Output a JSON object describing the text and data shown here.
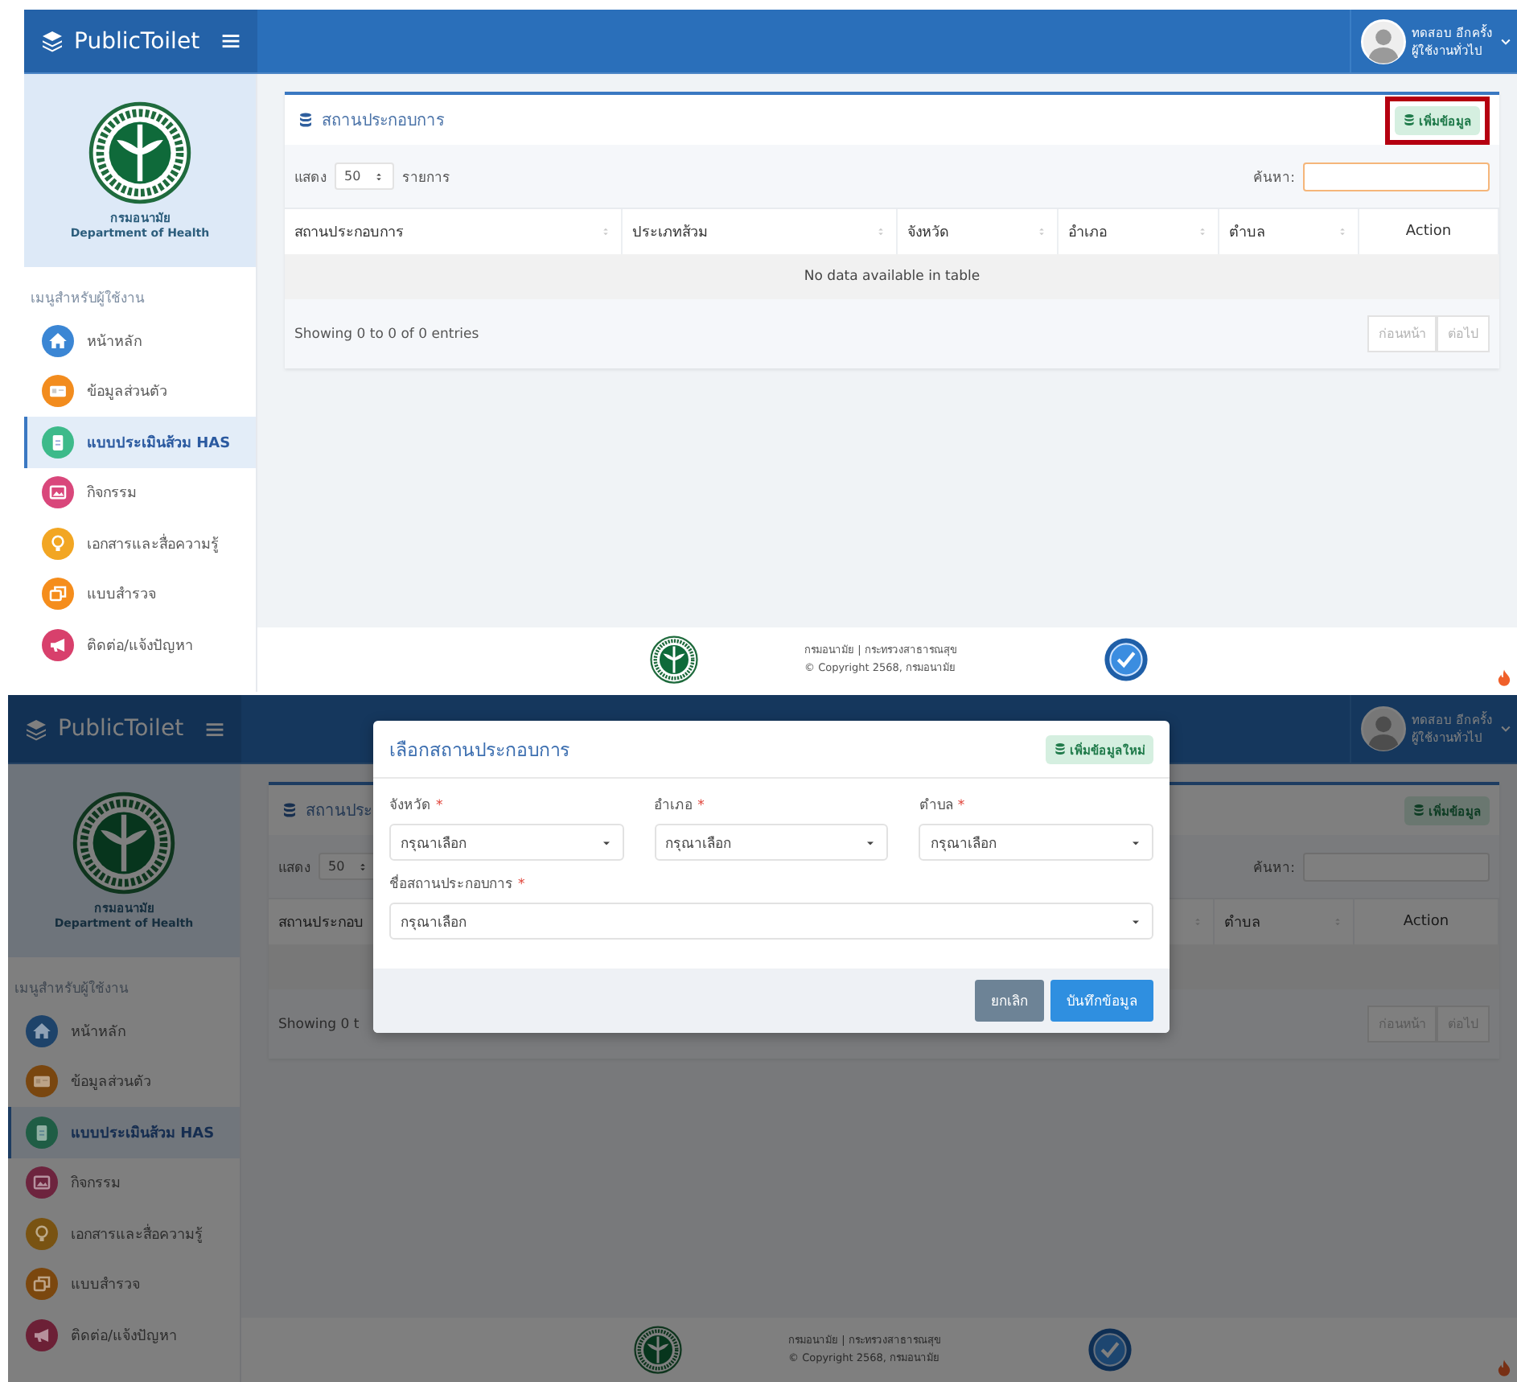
{
  "screens": [
    {
      "header": {
        "brand": "PublicToilet",
        "user_name": "ทดสอบ อีกครั้ง",
        "user_role": "ผู้ใช้งานทั่วไป"
      },
      "sidebar": {
        "org_th": "กรมอนามัย",
        "org_en": "Department of Health",
        "menu_title": "เมนูสำหรับผู้ใช้งาน",
        "items": [
          {
            "label": "หน้าหลัก",
            "color": "#3b86d4",
            "selected": false
          },
          {
            "label": "ข้อมูลส่วนตัว",
            "color": "#f28c1e",
            "selected": false
          },
          {
            "label": "แบบประเมินส้วม HAS",
            "color": "#3dba8a",
            "selected": true
          },
          {
            "label": "กิจกรรม",
            "color": "#d9477b",
            "selected": false
          },
          {
            "label": "เอกสารและสื่อความรู้",
            "color": "#f2a623",
            "selected": false
          },
          {
            "label": "แบบสำรวจ",
            "color": "#f58d1c",
            "selected": false
          },
          {
            "label": "ติดต่อ/แจ้งปัญหา",
            "color": "#d8406c",
            "selected": false
          }
        ]
      },
      "card": {
        "title": "สถานประกอบการ",
        "add_button": {
          "label": "เพิ่มข้อมูล",
          "highlighted": true
        },
        "show_label": "แสดง",
        "page_size": "50",
        "entries_label": "รายการ",
        "search_label": "ค้นหา:",
        "search_focused": true,
        "columns": [
          {
            "label": "สถานประกอบการ",
            "sortable": true
          },
          {
            "label": "ประเภทส้วม",
            "sortable": true
          },
          {
            "label": "จังหวัด",
            "sortable": true
          },
          {
            "label": "อำเภอ",
            "sortable": true
          },
          {
            "label": "ตำบล",
            "sortable": true
          },
          {
            "label": "Action",
            "sortable": false
          }
        ],
        "empty_message": "No data available in table",
        "info": "Showing 0 to 0 of 0 entries",
        "pager": [
          {
            "label": "ก่อนหน้า",
            "disabled": true
          },
          {
            "label": "ต่อไป",
            "disabled": true
          }
        ]
      },
      "footer": {
        "line_1": "กรมอนามัย | กระทรวงสาธารณสุข",
        "line_2": "© Copyright 2568, กรมอนามัย"
      }
    },
    {
      "header": {
        "brand": "PublicToilet",
        "user_name": "ทดสอบ อีกครั้ง",
        "user_role": "ผู้ใช้งานทั่วไป"
      },
      "sidebar": {
        "org_th": "กรมอนามัย",
        "org_en": "Department of Health",
        "menu_title": "เมนูสำหรับผู้ใช้งาน",
        "items": [
          {
            "label": "หน้าหลัก",
            "color": "#1e436a",
            "selected": false
          },
          {
            "label": "ข้อมูลส่วนตัว",
            "color": "#79460f",
            "selected": false
          },
          {
            "label": "แบบประเมินส้วม HAS",
            "color": "#1f5d45",
            "selected": true
          },
          {
            "label": "กิจกรรม",
            "color": "#6d243e",
            "selected": false
          },
          {
            "label": "เอกสารและสื่อความรู้",
            "color": "#795312",
            "selected": false
          },
          {
            "label": "แบบสำรวจ",
            "color": "#7b470e",
            "selected": false
          },
          {
            "label": "ติดต่อ/แจ้งปัญหา",
            "color": "#6c2036",
            "selected": false
          }
        ]
      },
      "card": {
        "title": "สถานประ",
        "add_button": {
          "label": "เพิ่มข้อมูล",
          "highlighted": false
        },
        "show_label": "แสดง",
        "page_size": "50",
        "search_label": "ค้นหา:",
        "search_focused": false,
        "columns": [
          {
            "label": "สถานประกอบ"
          },
          {
            "sortable": true
          },
          {
            "label": "ตำบล",
            "sortable": true
          },
          {
            "label": "Action",
            "sortable": false
          }
        ],
        "info": "Showing 0 t",
        "pager": [
          {
            "label": "ก่อนหน้า",
            "disabled": true
          },
          {
            "label": "ต่อไป",
            "disabled": true
          }
        ]
      },
      "footer": {
        "line_1": "กรมอนามัย | กระทรวงสาธารณสุข",
        "line_2": "© Copyright 2568, กรมอนามัย"
      },
      "modal": {
        "title": "เลือกสถานประกอบการ",
        "new_button": "เพิ่มข้อมูลใหม่",
        "rows": [
          [
            {
              "label": "จังหวัด",
              "required_mark": "*",
              "value": "กรุณาเลือก"
            },
            {
              "label": "อำเภอ",
              "required_mark": "*",
              "value": "กรุณาเลือก"
            },
            {
              "label": "ตำบล",
              "required_mark": "*",
              "value": "กรุณาเลือก"
            }
          ],
          [
            {
              "label": "ชื่อสถานประกอบการ",
              "required_mark": "*",
              "value": "กรุณาเลือก"
            }
          ]
        ],
        "buttons": [
          {
            "label": "ยกเลิก",
            "kind": "cancel"
          },
          {
            "label": "บันทึกข้อมูล",
            "kind": "primary"
          }
        ]
      }
    }
  ]
}
